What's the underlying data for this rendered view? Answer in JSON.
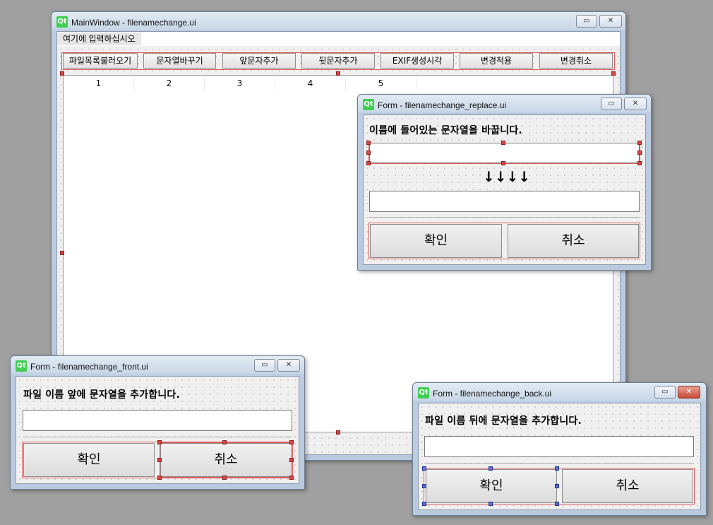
{
  "main_window": {
    "title": "MainWindow - filenamechange.ui",
    "menu_placeholder": "여기에 입력하십시오",
    "toolbar": [
      "파일목록불러오기",
      "문자열바꾸기",
      "앞문자추가",
      "뒷문자추가",
      "EXIF생성시각",
      "변경적용",
      "변경취소"
    ],
    "columns": [
      "1",
      "2",
      "3",
      "4",
      "5"
    ]
  },
  "replace_form": {
    "title": "Form - filenamechange_replace.ui",
    "label": "이름에 들어있는 문자열을 바꿉니다.",
    "arrows": "↓↓↓↓",
    "ok_label": "확인",
    "cancel_label": "취소"
  },
  "front_form": {
    "title": "Form - filenamechange_front.ui",
    "label": "파일 이름 앞에 문자열을 추가합니다.",
    "ok_label": "확인",
    "cancel_label": "취소"
  },
  "back_form": {
    "title": "Form - filenamechange_back.ui",
    "label": "파일 이름 뒤에 문자열을 추가합니다.",
    "ok_label": "확인",
    "cancel_label": "취소"
  },
  "window_buttons": {
    "minimize": "▭",
    "close": "✕"
  },
  "colors": {
    "selection_red": "#e05a5a",
    "selection_blue": "#5a72e0",
    "qt_green": "#41cd52"
  }
}
